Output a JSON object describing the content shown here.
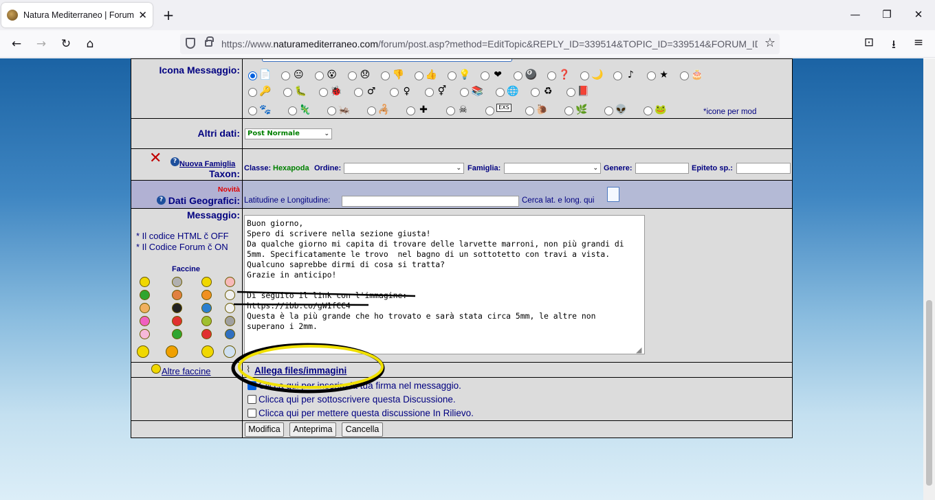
{
  "browser": {
    "tab_title": "Natura Mediterraneo | Forum N",
    "tab_close": "✕",
    "new_tab": "+",
    "url_prefix": "https://www.",
    "url_domain": "naturamediterraneo.com",
    "url_rest": "/forum/post.asp?method=EditTopic&REPLY_ID=339514&TOPIC_ID=339514&FORUM_ID",
    "minimize": "—",
    "maximize": "❐",
    "close": "✕",
    "back": "←",
    "forward": "→",
    "reload": "↻",
    "home": "⌂",
    "bookmark": "☆",
    "pocket": "⊡",
    "downloads": "⭳",
    "menu": "≡"
  },
  "form": {
    "icon_label": "Icona Messaggio:",
    "icon_mod_note": "*icone per mod",
    "altri_label": "Altri dati:",
    "altri_value": "Post Normale",
    "nuova_famiglia": "Nuova Famiglia",
    "taxon_label": "Taxon:",
    "classe_label": "Classe:",
    "classe_value": "Hexapoda",
    "ordine_label": "Ordine:",
    "famiglia_label": "Famiglia:",
    "genere_label": "Genere:",
    "epiteto_label": "Epiteto sp.:",
    "novita": "Novità",
    "geo_label": "Dati Geografici:",
    "latlong_label": "Latitudine e Longitudine:",
    "cerca_link": "Cerca lat. e long. qui",
    "messaggio_label": "Messaggio:",
    "html_note": "* Il codice HTML č OFF",
    "forum_note": "* Il Codice Forum č ON",
    "faccine_title": "Faccine",
    "altre_faccine": "Altre faccine",
    "allega": "Allega files/immagini",
    "message_text": "Buon giorno,\nSpero di scrivere nella sezione giusta!\nDa qualche giorno mi capita di trovare delle larvette marroni, non più grandi di\n5mm. Specificatamente le trovo  nel bagno di un sottotetto con travi a vista.\nQualcuno saprebbe dirmi di cosa si tratta?\nGrazie in anticipo!\n\nDi seguito il link con l'immagine:\nhttps://ibb.co/gW1fCC4\nQuesta è la più grande che ho trovato e sarà stata circa 5mm, le altre non\nsuperano i 2mm.",
    "check_firma": "Clicca qui per inserire la tua firma nel messaggio.",
    "check_sottoscrivi": "Clicca qui per sottoscrivere questa Discussione.",
    "check_rilievo": "Clicca qui per mettere questa discussione In Rilievo.",
    "btn_modifica": "Modifica",
    "btn_anteprima": "Anteprima",
    "btn_cancella": "Cancella",
    "help": "?"
  },
  "icons_row1": [
    "📄",
    "😐",
    "😮",
    "😞",
    "👎",
    "👍",
    "💡",
    "❤",
    "🎱",
    "❓",
    "🌙",
    "♪",
    "★",
    "🎂"
  ],
  "icons_row2": [
    "🔑",
    "🐛",
    "🐞",
    "♂",
    "♀",
    "⚥",
    "📚",
    "🌐",
    "♻",
    "📕"
  ],
  "icons_row3": [
    "🐾",
    "🦎",
    "🦗",
    "🦂",
    "✚",
    "☠",
    "EXS",
    "🐌",
    "🌿",
    "👽",
    "🐸"
  ],
  "smileys": [
    [
      "#f0d800",
      "#b0b0b0",
      "#f0d800",
      "#f7b9b9"
    ],
    [
      "#2fa52f",
      "#e08040",
      "#f09020",
      "#f0f0f0"
    ],
    [
      "#f0b060",
      "#222222",
      "#2a7fd0",
      "#f0f0f0"
    ],
    [
      "#f060c0",
      "#e03030",
      "#9fc030",
      "#a0a0a0"
    ],
    [
      "#f7b9d9",
      "#2fa52f",
      "#e03030",
      "#3070c0"
    ]
  ]
}
